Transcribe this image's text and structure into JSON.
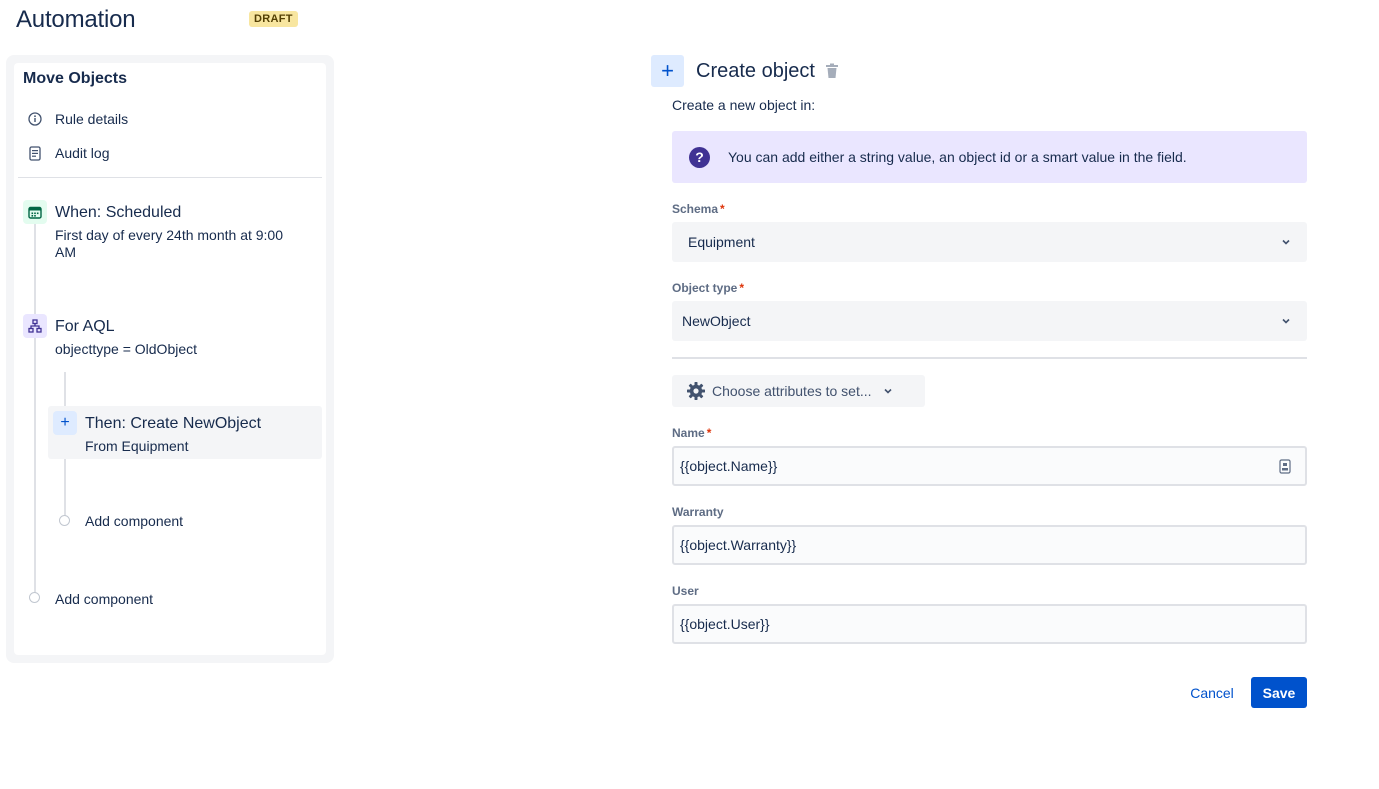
{
  "header": {
    "title": "Automation",
    "badge": "DRAFT"
  },
  "sidebar": {
    "rule_name": "Move Objects",
    "nav": [
      {
        "label": "Rule details",
        "icon": "info-icon"
      },
      {
        "label": "Audit log",
        "icon": "document-icon"
      }
    ],
    "steps": {
      "trigger": {
        "title": "When: Scheduled",
        "sub_line1": "First day of every 24th month at 9:00",
        "sub_line2": "AM",
        "icon": "calendar-icon",
        "color": "#e3fcef"
      },
      "branch": {
        "title": "For AQL",
        "sub": "objecttype = OldObject",
        "icon": "branch-icon",
        "color": "#eae6ff"
      },
      "action": {
        "title": "Then: Create NewObject",
        "sub": "From Equipment",
        "icon": "plus-icon",
        "color": "#deebff"
      }
    },
    "add_inner": "Add component",
    "add_outer": "Add component"
  },
  "panel": {
    "title": "Create object",
    "intro": "Create a new object in:",
    "info": "You can add either a string value, an object id or a smart value in the field.",
    "schema": {
      "label": "Schema",
      "value": "Equipment"
    },
    "object_type": {
      "label": "Object type",
      "value": "NewObject"
    },
    "attributes_button": "Choose attributes to set...",
    "fields": {
      "name": {
        "label": "Name",
        "value": "{{object.Name}}"
      },
      "warranty": {
        "label": "Warranty",
        "value": "{{object.Warranty}}"
      },
      "user": {
        "label": "User",
        "value": "{{object.User}}"
      }
    },
    "cancel": "Cancel",
    "save": "Save"
  },
  "colors": {
    "primary": "#0052cc",
    "info_bg": "#eae6ff",
    "badge_bg": "#f8e6a0"
  }
}
